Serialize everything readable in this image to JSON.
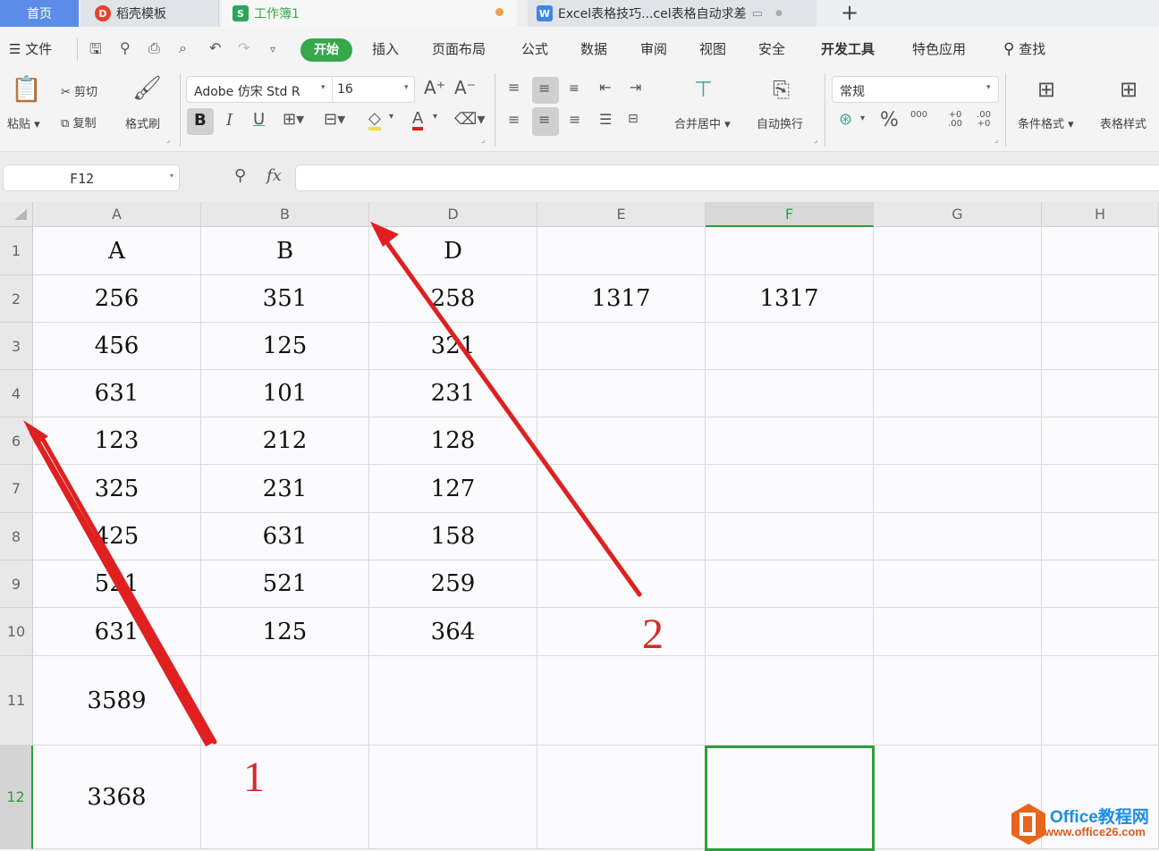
{
  "tabs": {
    "home": "首页",
    "template": "稻壳模板",
    "workbook": "工作簿1",
    "document": "Excel表格技巧...cel表格自动求差",
    "new_tab": "+"
  },
  "menu": {
    "file": "文件",
    "items": [
      "开始",
      "插入",
      "页面布局",
      "公式",
      "数据",
      "审阅",
      "视图",
      "安全",
      "开发工具",
      "特色应用"
    ],
    "search": "查找"
  },
  "ribbon": {
    "paste": "粘贴",
    "cut": "剪切",
    "copy": "复制",
    "format_painter": "格式刷",
    "font_name": "Adobe 仿宋 Std R",
    "font_size": "16",
    "merge_center": "合并居中",
    "wrap_text": "自动换行",
    "number_format": "常规",
    "conditional_format": "条件格式",
    "table_style": "表格样式",
    "percent": "%",
    "thousands": "000",
    "inc_decimal": "+0 .00",
    "dec_decimal": ".00 +0"
  },
  "formula_bar": {
    "name_box": "F12",
    "fx": "fx",
    "formula": ""
  },
  "sheet": {
    "columns": [
      "A",
      "B",
      "D",
      "E",
      "F",
      "G",
      "H"
    ],
    "selected_column": "F",
    "rows": [
      {
        "num": "1",
        "cells": [
          "A",
          "B",
          "D",
          "",
          "",
          "",
          ""
        ]
      },
      {
        "num": "2",
        "cells": [
          "256",
          "351",
          "258",
          "1317",
          "1317",
          "",
          ""
        ]
      },
      {
        "num": "3",
        "cells": [
          "456",
          "125",
          "321",
          "",
          "",
          "",
          ""
        ]
      },
      {
        "num": "4",
        "cells": [
          "631",
          "101",
          "231",
          "",
          "",
          "",
          ""
        ]
      },
      {
        "num": "6",
        "cells": [
          "123",
          "212",
          "128",
          "",
          "",
          "",
          ""
        ]
      },
      {
        "num": "7",
        "cells": [
          "325",
          "231",
          "127",
          "",
          "",
          "",
          ""
        ]
      },
      {
        "num": "8",
        "cells": [
          "425",
          "631",
          "158",
          "",
          "",
          "",
          ""
        ]
      },
      {
        "num": "9",
        "cells": [
          "521",
          "521",
          "259",
          "",
          "",
          "",
          ""
        ]
      },
      {
        "num": "10",
        "cells": [
          "631",
          "125",
          "364",
          "",
          "",
          "",
          ""
        ]
      },
      {
        "num": "11",
        "cells": [
          "3589",
          "",
          "",
          "",
          "",
          "",
          ""
        ]
      },
      {
        "num": "12",
        "cells": [
          "3368",
          "",
          "",
          "",
          "",
          "",
          ""
        ]
      }
    ],
    "selected_row": "12",
    "active_cell": "F12"
  },
  "annotations": {
    "label_1": "1",
    "label_2": "2"
  },
  "watermark": {
    "title": "Office教程网",
    "url": "www.office26.com"
  },
  "colors": {
    "accent_green": "#36a84a",
    "home_tab": "#5b8de8",
    "annotation_red": "#d42a2a"
  }
}
